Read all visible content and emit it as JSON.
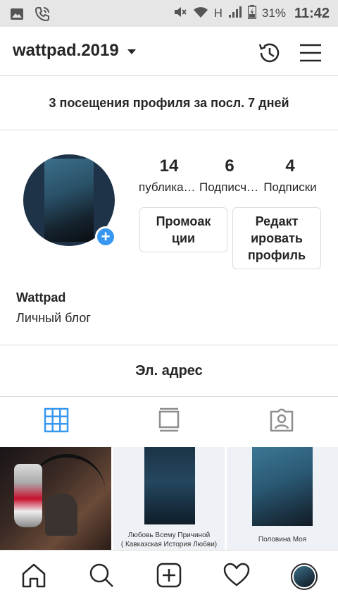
{
  "status_bar": {
    "network_letter": "H",
    "battery": "31%",
    "time": "11:42"
  },
  "header": {
    "username": "wattpad.2019"
  },
  "visits_banner": "3 посещения профиля за посл. 7 дней",
  "profile": {
    "stats": [
      {
        "value": "14",
        "label": "публикации"
      },
      {
        "value": "6",
        "label": "Подписчики"
      },
      {
        "value": "4",
        "label": "Подписки"
      }
    ],
    "promo_button": "Промоак\nции",
    "edit_button": "Редакт\nировать\nпрофиль",
    "name": "Wattpad",
    "bio": "Личный блог"
  },
  "email_button": "Эл. адрес",
  "tabs": [
    {
      "icon": "grid-icon",
      "active": true
    },
    {
      "icon": "feed-icon",
      "active": false
    },
    {
      "icon": "tagged-icon",
      "active": false
    }
  ],
  "posts": [
    {
      "caption_1": "",
      "caption_2": ""
    },
    {
      "caption_1": "Любовь Всему Причиной",
      "caption_2": "( Кавказская История Любви)"
    },
    {
      "caption_1": "Половина Моя",
      "caption_2": ""
    }
  ],
  "bottom_nav": [
    "home-icon",
    "search-icon",
    "add-post-icon",
    "heart-icon",
    "profile-avatar"
  ],
  "colors": {
    "accent": "#3897f0",
    "text": "#262626",
    "divider": "#dbdbdb",
    "status_bar_bg": "#e6e6e6"
  }
}
